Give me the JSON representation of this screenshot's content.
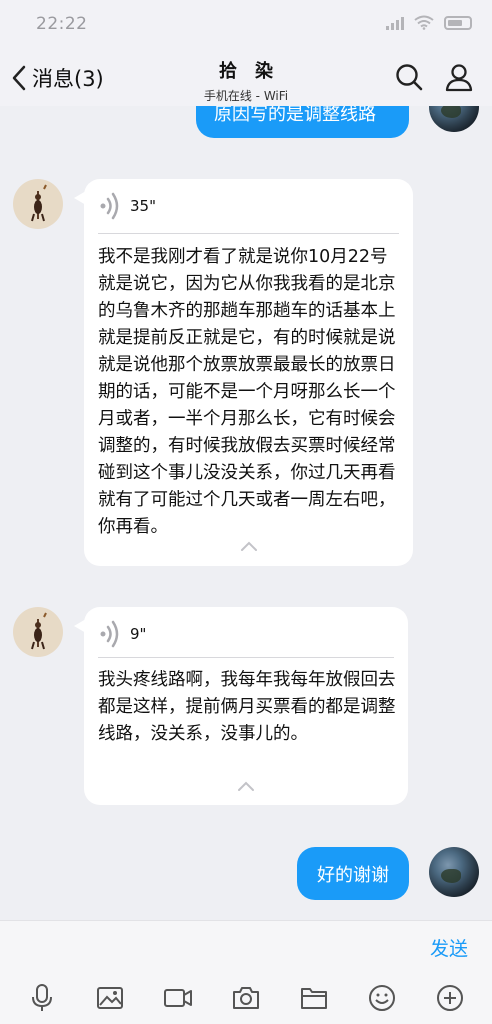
{
  "status_bar": {
    "time": "22:22"
  },
  "header": {
    "back_label": "消息(3)",
    "contact_name": "拾染",
    "contact_status": "手机在线 - WiFi",
    "icons": [
      "back-chevron-icon",
      "search-icon",
      "profile-icon"
    ]
  },
  "messages": [
    {
      "from": "me",
      "type": "text",
      "text": "原因写的是调整线路"
    },
    {
      "from": "other",
      "type": "voice",
      "duration": "35\"",
      "transcript": "我不是我刚才看了就是说你10月22号就是说它，因为它从你我我看的是北京的乌鲁木齐的那趟车那趟车的话基本上就是提前反正就是它，有的时候就是说就是说他那个放票放票最最长的放票日期的话，可能不是一个月呀那么长一个月或者，一半个月那么长，它有时候会调整的，有时候我放假去买票时候经常碰到这个事儿没没关系，你过几天再看就有了可能过个几天或者一周左右吧，你再看。"
    },
    {
      "from": "other",
      "type": "voice",
      "duration": "9\"",
      "transcript": "我头疼线路啊，我每年我每年放假回去都是这样，提前俩月买票看的都是调整线路，没关系，没事儿的。"
    },
    {
      "from": "me",
      "type": "text",
      "text": "好的谢谢"
    }
  ],
  "input": {
    "send_label": "发送"
  },
  "toolbar": {
    "icons": [
      "microphone-icon",
      "image-icon",
      "video-icon",
      "camera-icon",
      "folder-icon",
      "emoji-icon",
      "plus-icon"
    ]
  },
  "colors": {
    "accent": "#1a9bf8",
    "background": "#eeeff3",
    "card": "#ffffff"
  }
}
